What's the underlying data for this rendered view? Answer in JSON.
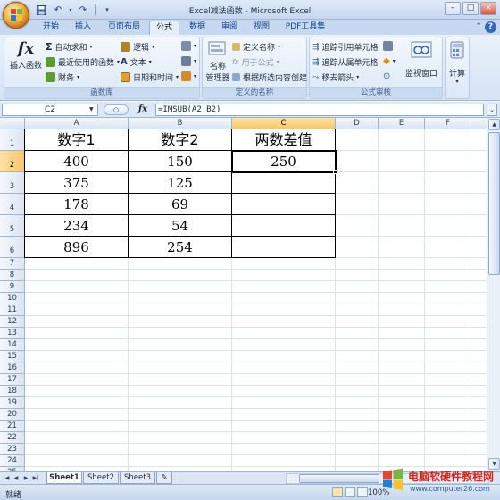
{
  "window": {
    "title": "Excel减法函数 - Microsoft Excel",
    "controls": [
      "–",
      "□",
      "×"
    ]
  },
  "tabs": [
    {
      "label": "开始",
      "active": false
    },
    {
      "label": "插入",
      "active": false
    },
    {
      "label": "页面布局",
      "active": false
    },
    {
      "label": "公式",
      "active": true
    },
    {
      "label": "数据",
      "active": false
    },
    {
      "label": "审阅",
      "active": false
    },
    {
      "label": "视图",
      "active": false
    },
    {
      "label": "PDF工具集",
      "active": false
    }
  ],
  "ribbon": {
    "function_library": {
      "label": "函数库",
      "insert_function": "插入函数",
      "autosum": "自动求和",
      "recent": "最近使用的函数",
      "financial": "财务",
      "logical": "逻辑",
      "text": "文本",
      "datetime": "日期和时间"
    },
    "defined_names": {
      "label": "定义的名称",
      "name_manager_line1": "名称",
      "name_manager_line2": "管理器",
      "define_name": "定义名称",
      "use_in_formula": "用于公式",
      "create_from_selection": "根据所选内容创建"
    },
    "formula_auditing": {
      "label": "公式审核",
      "trace_precedents": "追踪引用单元格",
      "trace_dependents": "追踪从属单元格",
      "remove_arrows": "移去箭头",
      "watch_window": "监视窗口"
    },
    "calculation": {
      "label": "计算"
    }
  },
  "formula_bar": {
    "name_box": "C2",
    "fx": "fx",
    "formula": "=IMSUB(A2,B2)"
  },
  "grid": {
    "columns": [
      "A",
      "B",
      "C",
      "D",
      "E",
      "F"
    ],
    "selected_column": "C",
    "rows": [
      "1",
      "2",
      "3",
      "4",
      "5",
      "6",
      "7",
      "8",
      "9",
      "10",
      "11",
      "12",
      "13",
      "14",
      "15",
      "16",
      "17",
      "18",
      "19",
      "20",
      "21",
      "22",
      "23",
      "24",
      "25"
    ],
    "selected_row": "2",
    "headers": [
      "数字1",
      "数字2",
      "两数差值"
    ],
    "data": [
      [
        "400",
        "150",
        "250"
      ],
      [
        "375",
        "125",
        ""
      ],
      [
        "178",
        "69",
        ""
      ],
      [
        "234",
        "54",
        ""
      ],
      [
        "896",
        "254",
        ""
      ]
    ]
  },
  "sheets": [
    {
      "label": "Sheet1",
      "active": true
    },
    {
      "label": "Sheet2",
      "active": false
    },
    {
      "label": "Sheet3",
      "active": false
    }
  ],
  "status": {
    "ready": "就绪",
    "zoom": "100%"
  },
  "watermark": {
    "brand": "电脑软硬件教程网",
    "url": "www.computer26.com"
  },
  "colors": {
    "selection_header": "#f7c66b",
    "ribbon_bg": "#d5e3f5",
    "accent_blue": "#15428b"
  }
}
